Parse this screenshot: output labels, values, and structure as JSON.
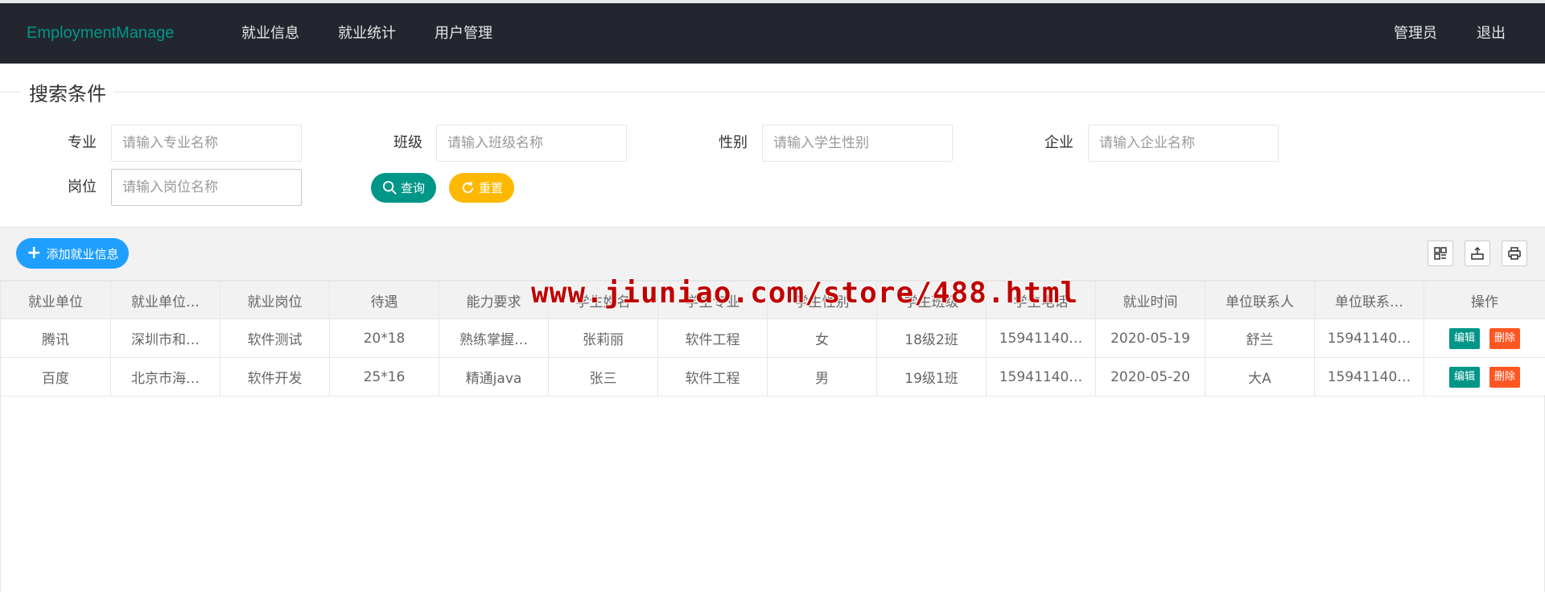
{
  "nav": {
    "brand": "EmploymentManage",
    "items": [
      "就业信息",
      "就业统计",
      "用户管理"
    ],
    "admin": "管理员",
    "logout": "退出"
  },
  "search": {
    "legend": "搜索条件",
    "fields": [
      {
        "label": "专业",
        "placeholder": "请输入专业名称"
      },
      {
        "label": "班级",
        "placeholder": "请输入班级名称"
      },
      {
        "label": "性别",
        "placeholder": "请输入学生性别"
      },
      {
        "label": "企业",
        "placeholder": "请输入企业名称"
      },
      {
        "label": "岗位",
        "placeholder": "请输入岗位名称"
      }
    ],
    "query_label": "查询",
    "reset_label": "重置"
  },
  "toolbar": {
    "add_label": "添加就业信息"
  },
  "table": {
    "headers": [
      "就业单位",
      "就业单位…",
      "就业岗位",
      "待遇",
      "能力要求",
      "学生姓名",
      "学生专业",
      "学生性别",
      "学生班级",
      "学生电话",
      "就业时间",
      "单位联系人",
      "单位联系…",
      "操作"
    ],
    "rows": [
      [
        "腾讯",
        "深圳市和…",
        "软件测试",
        "20*18",
        "熟练掌握…",
        "张莉丽",
        "软件工程",
        "女",
        "18级2班",
        "15941140…",
        "2020-05-19",
        "舒兰",
        "15941140…"
      ],
      [
        "百度",
        "北京市海…",
        "软件开发",
        "25*16",
        "精通java",
        "张三",
        "软件工程",
        "男",
        "19级1班",
        "15941140…",
        "2020-05-20",
        "大A",
        "15941140…"
      ]
    ],
    "edit_label": "编辑",
    "delete_label": "删除"
  },
  "watermark": "www.jiuniao.com/store/488.html",
  "colors": {
    "nav_bg": "#23262e",
    "brand": "#009688",
    "query": "#009688",
    "reset": "#ffb800",
    "add": "#1e9fff",
    "delete": "#ff5722"
  }
}
